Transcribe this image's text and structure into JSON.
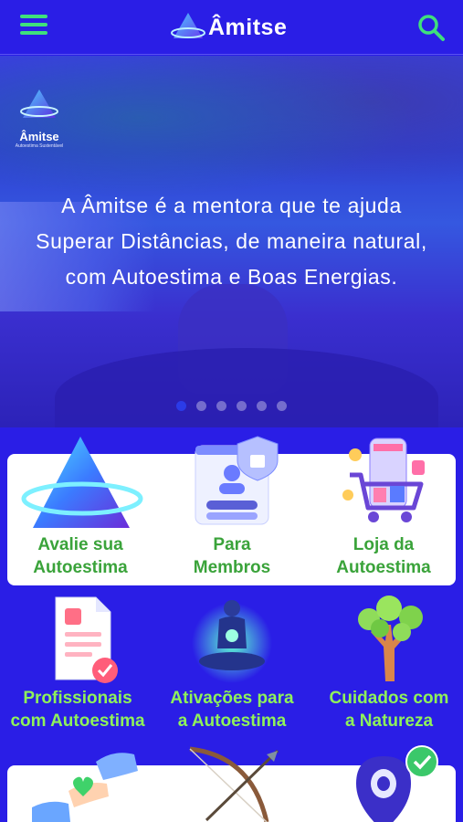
{
  "header": {
    "brand": "Âmitse",
    "menu_icon": "hamburger-menu-icon",
    "search_icon": "search-icon",
    "accent": "#3fe07c",
    "background": "#2a1ee6"
  },
  "hero": {
    "logo_name": "Âmitse",
    "logo_tagline": "Autoestima Sustentável",
    "lines": [
      "A Âmitse é a mentora que te ajuda",
      "Superar Distâncias, de maneira natural,",
      "com Autoestima e Boas Energias."
    ],
    "slides": 6,
    "active_slide": 1
  },
  "tiles_row1": [
    {
      "line1": "Avalie sua",
      "line2": "Autoestima",
      "icon": "triangle-logo-icon"
    },
    {
      "line1": "Para",
      "line2": "Membros",
      "icon": "member-login-icon"
    },
    {
      "line1": "Loja da",
      "line2": "Autoestima",
      "icon": "shopping-cart-icon"
    }
  ],
  "tiles_row2": [
    {
      "line1": "Profissionais",
      "line2": "com Autoestima",
      "icon": "document-check-icon"
    },
    {
      "line1": "Ativações para",
      "line2": "a Autoestima",
      "icon": "meditation-icon"
    },
    {
      "line1": "Cuidados com",
      "line2": "a Natureza",
      "icon": "tree-icon"
    }
  ],
  "tiles_row3": [
    {
      "icon": "hand-heart-icon"
    },
    {
      "icon": "bow-arrow-icon"
    },
    {
      "icon": "location-pin-icon"
    }
  ],
  "colors": {
    "label_on_white": "#3aa33a",
    "label_on_blue": "#8ff25a"
  }
}
